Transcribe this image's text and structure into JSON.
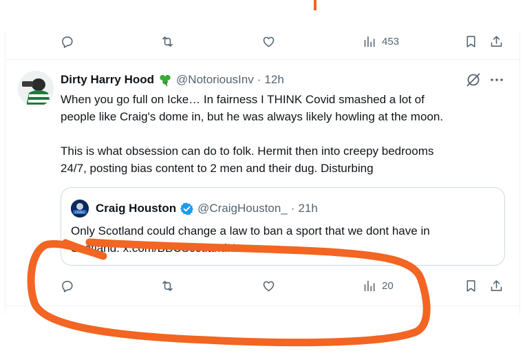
{
  "top_actions": {
    "views_count": "453"
  },
  "tweet": {
    "display_name": "Dirty Harry Hood",
    "handle": "@NotoriousInv",
    "separator": "·",
    "time": "12h",
    "lines": [
      "When you go full on Icke… In fairness I THINK Covid smashed a lot of",
      "people like Craig's dome in, but he was always likely howling at the moon.",
      "This is what obsession can do to folk. Hermit then into creepy bedrooms",
      "24/7, posting bias content to 2 men and their dug. Disturbing"
    ]
  },
  "quoted": {
    "display_name": "Craig Houston",
    "handle": "@CraigHouston_",
    "separator": "·",
    "time": "21h",
    "lines": [
      "Only Scotland could change a law to ban a sport that we dont have in",
      "Scotland. x.com/BBCScotlandNew…"
    ],
    "avatar_text": "CRAIG"
  },
  "bottom_actions": {
    "views_count": "20"
  },
  "icons": {
    "reply": "reply-icon",
    "retweet": "retweet-icon",
    "like": "like-icon",
    "views": "views-icon",
    "bookmark": "bookmark-icon",
    "share": "share-icon",
    "grok": "grok-icon",
    "more": "more-icon",
    "shamrock": "shamrock-icon",
    "verified": "verified-badge-icon"
  },
  "colors": {
    "annotation": "#f26522",
    "verified": "#1d9bf0",
    "shamrock": "#3aa935",
    "muted": "#536471"
  }
}
